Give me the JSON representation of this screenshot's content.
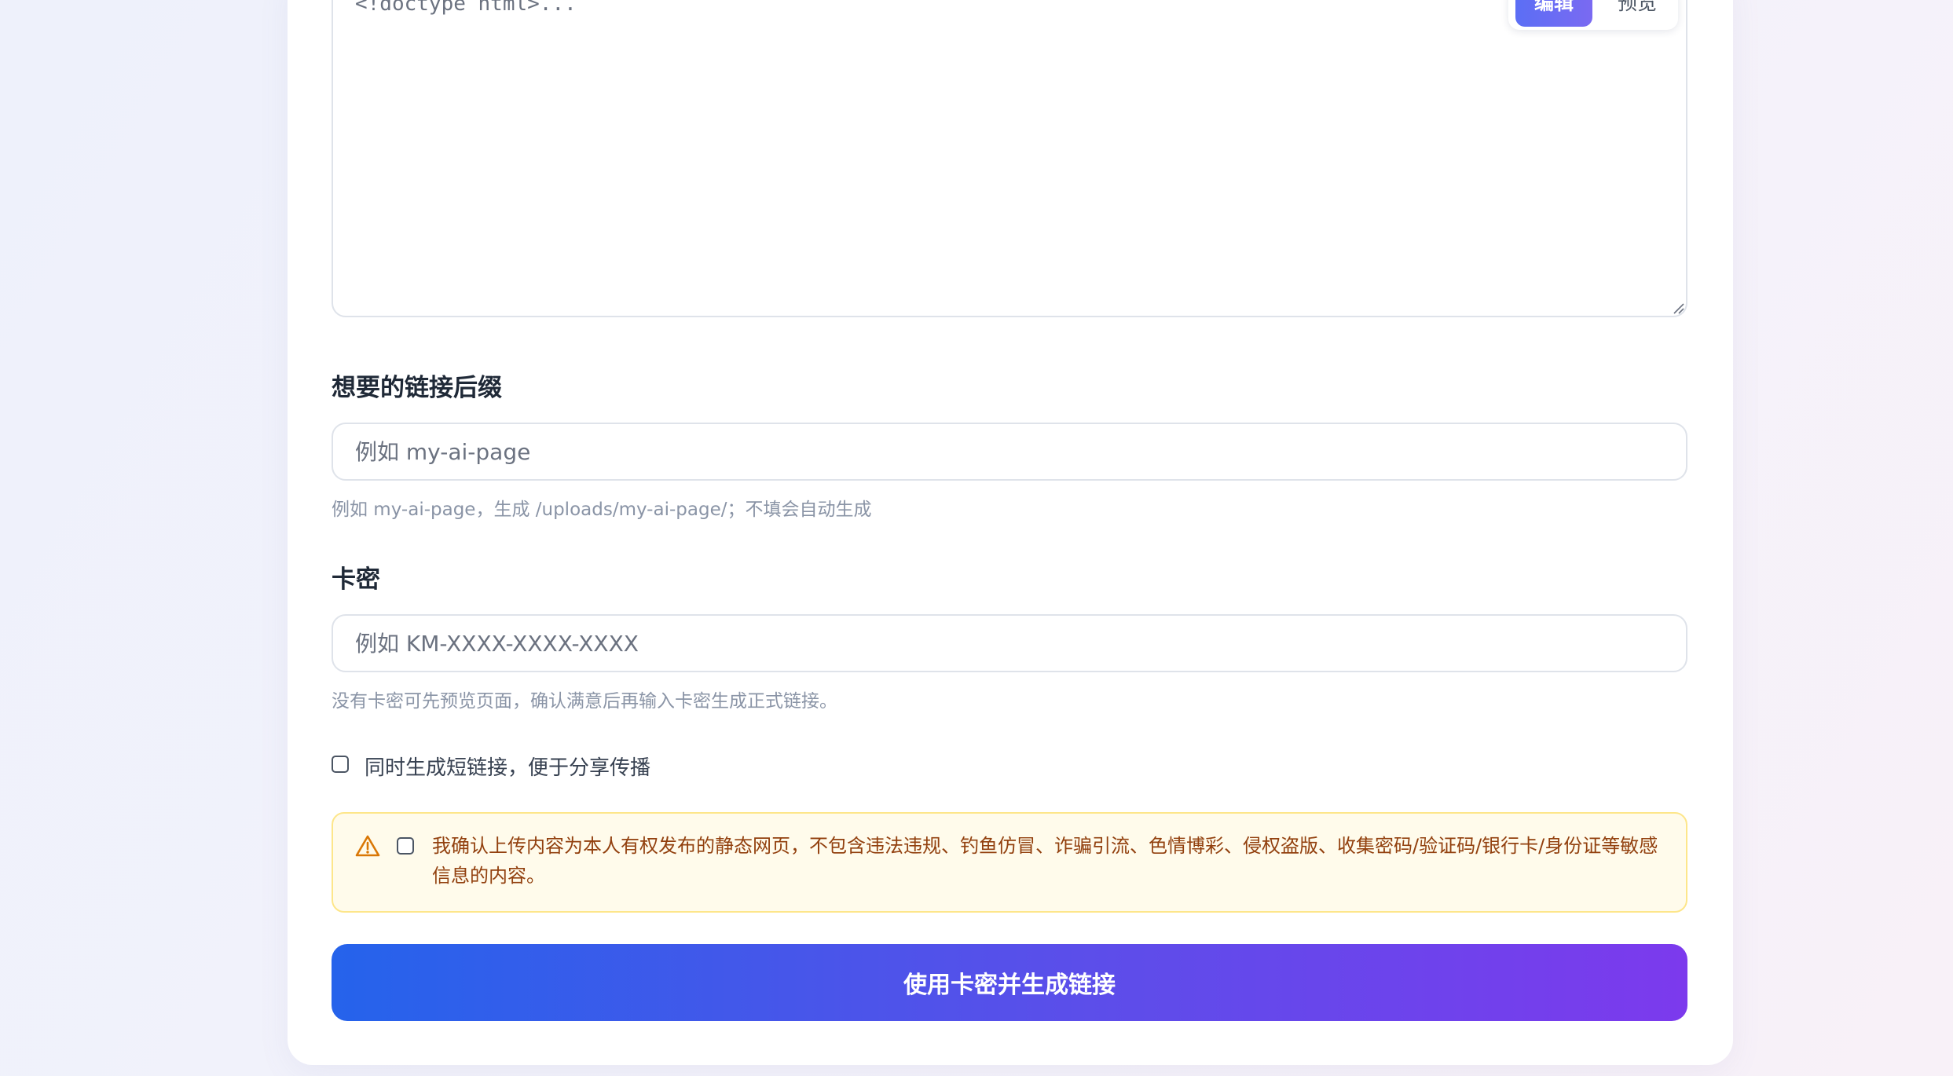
{
  "editor": {
    "code": "<!doctype html>...",
    "mode_edit_label": "编辑",
    "mode_preview_label": "预览"
  },
  "suffix": {
    "label": "想要的链接后缀",
    "placeholder": "例如 my-ai-page",
    "help": "例如 my-ai-page，生成 /uploads/my-ai-page/；不填会自动生成"
  },
  "card_key": {
    "label": "卡密",
    "placeholder": "例如 KM-XXXX-XXXX-XXXX",
    "help": "没有卡密可先预览页面，确认满意后再输入卡密生成正式链接。"
  },
  "short_link": {
    "label": "同时生成短链接，便于分享传播",
    "checked": false
  },
  "agreement": {
    "icon": "warning-triangle-icon",
    "text": "我确认上传内容为本人有权发布的静态网页，不包含违法违规、钓鱼仿冒、诈骗引流、色情博彩、侵权盗版、收集密码/验证码/银行卡/身份证等敏感信息的内容。",
    "checked": false
  },
  "submit": {
    "label": "使用卡密并生成链接"
  },
  "colors": {
    "accent_start": "#2563eb",
    "accent_end": "#7c3aed",
    "warning_bg": "#fffbeb",
    "warning_border": "#fde68a",
    "warning_text": "#92400e"
  }
}
